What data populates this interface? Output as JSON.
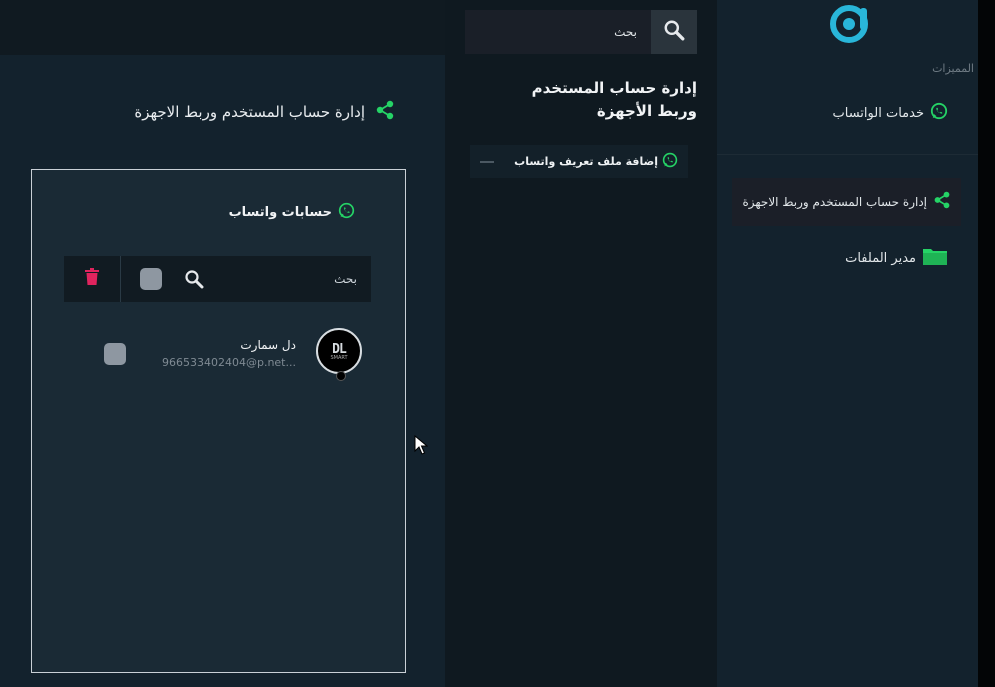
{
  "sidebar": {
    "section_label": "المميزات",
    "items": [
      {
        "label": "خدمات الواتساب",
        "icon": "whatsapp-icon"
      },
      {
        "label": "إدارة حساب المستخدم وربط الاجهزة",
        "icon": "share-icon",
        "active": true
      },
      {
        "label": "مدير الملفات",
        "icon": "folder-icon"
      }
    ]
  },
  "middle": {
    "search_placeholder": "بحث",
    "title": "إدارة حساب المستخدم وربط الأجهزة",
    "items": [
      {
        "label": "إضافة ملف تعريف واتساب",
        "icon": "whatsapp-icon"
      }
    ]
  },
  "main": {
    "title": "إدارة حساب المستخدم وربط الاجهزة",
    "card": {
      "header": "حسابات واتساب",
      "search_placeholder": "بحث",
      "accounts": [
        {
          "name": "دل سمارت",
          "number": "966533402404@p.net...",
          "avatar_text": "DL",
          "avatar_sub": "SMART"
        }
      ]
    }
  },
  "colors": {
    "accent_green": "#25d366",
    "logo_cyan": "#29b6d9",
    "delete_red": "#e0245e"
  }
}
